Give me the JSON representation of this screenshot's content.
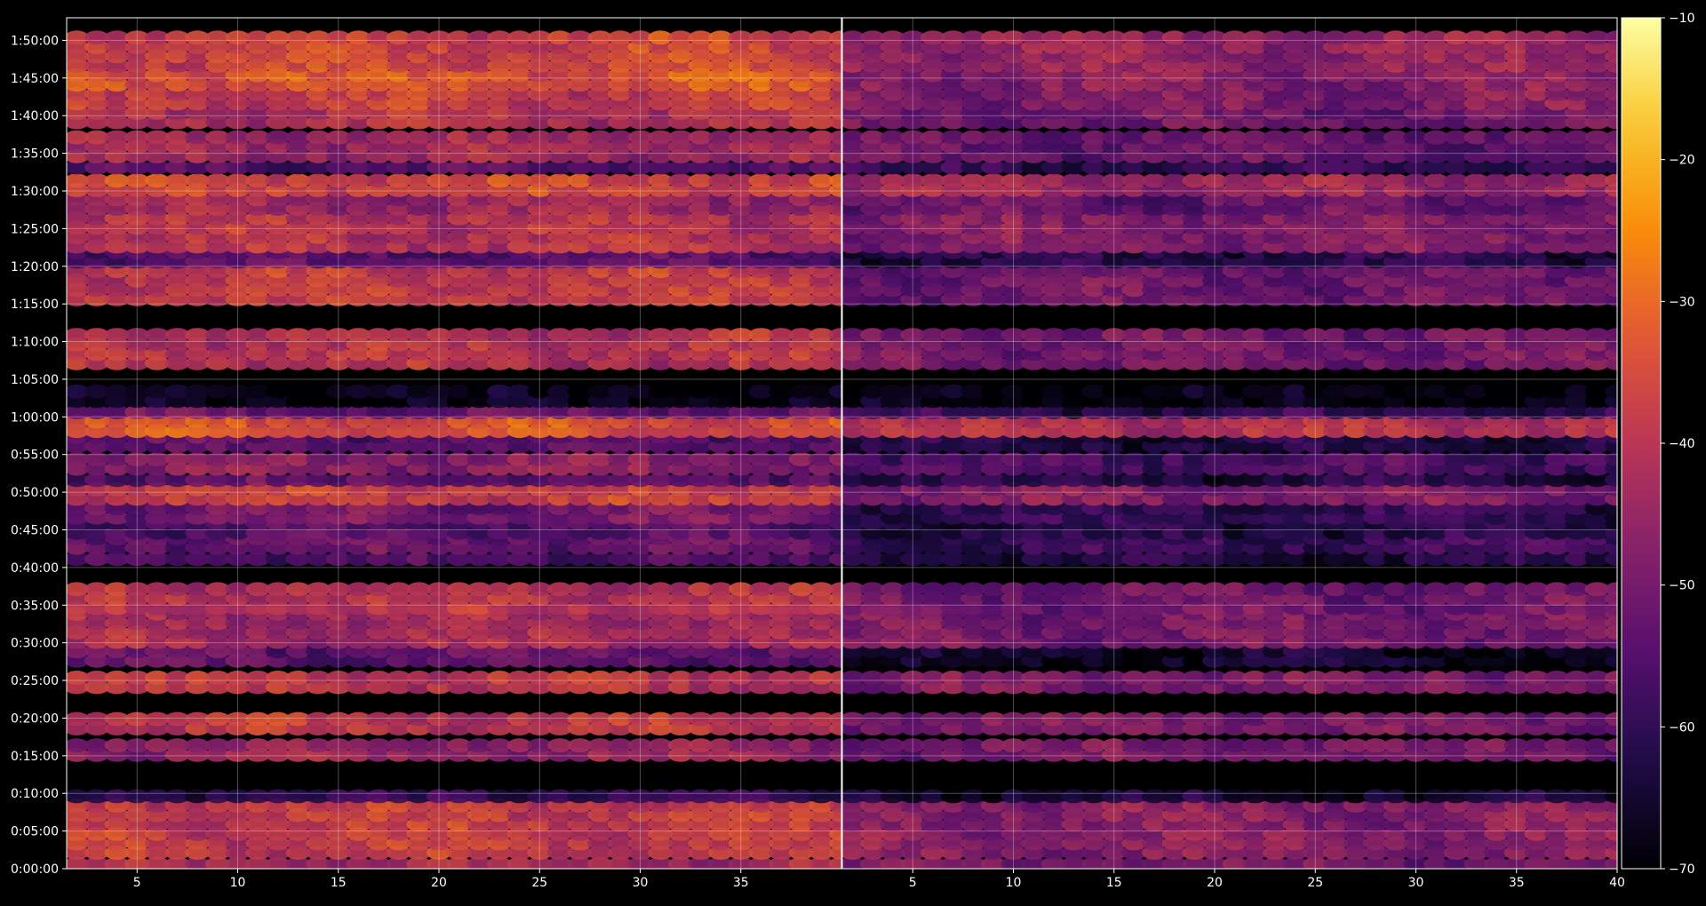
{
  "chart_data": {
    "type": "heatmap",
    "title": "",
    "xlabel": "",
    "ylabel": "",
    "grid": true,
    "panels": [
      {
        "name": "",
        "xlim": [
          1.5,
          40
        ],
        "x_ticks": [
          5,
          10,
          15,
          20,
          25,
          30,
          35
        ],
        "x_tick_labels": [
          "5",
          "10",
          "15",
          "20",
          "25",
          "30",
          "35"
        ],
        "channels": [
          2,
          40
        ],
        "level_profile": [
          [
            0,
            1.5,
            -43
          ],
          [
            1.5,
            9,
            -38
          ],
          [
            9,
            10.5,
            -60
          ],
          [
            14.5,
            16.5,
            -45
          ],
          [
            18,
            21,
            -39
          ],
          [
            23.5,
            25.5,
            -39
          ],
          [
            27,
            29.5,
            -53
          ],
          [
            29.5,
            34,
            -43
          ],
          [
            34,
            37.5,
            -40
          ],
          [
            40.5,
            42,
            -56
          ],
          [
            42,
            44,
            -52
          ],
          [
            44,
            46,
            -55
          ],
          [
            46,
            48.5,
            -50
          ],
          [
            48.5,
            51,
            -37
          ],
          [
            51,
            52.5,
            -53
          ],
          [
            52.5,
            55.5,
            -47
          ],
          [
            55.5,
            57.5,
            -54
          ],
          [
            57.5,
            60,
            -34
          ],
          [
            60,
            61.5,
            -52
          ],
          [
            61.5,
            63.5,
            -68
          ],
          [
            66.5,
            72,
            -40
          ],
          [
            75,
            80,
            -38
          ],
          [
            80,
            82,
            -54
          ],
          [
            82,
            86.5,
            -40
          ],
          [
            87,
            89.5,
            -44
          ],
          [
            89.5,
            91.5,
            -36
          ],
          [
            92.5,
            94,
            -55
          ],
          [
            94,
            98,
            -44
          ],
          [
            98.5,
            101,
            -41
          ],
          [
            101,
            103.5,
            -38
          ],
          [
            103.5,
            106,
            -33
          ],
          [
            106,
            111,
            -36
          ]
        ]
      },
      {
        "name": "",
        "xlim": [
          1.5,
          40
        ],
        "x_ticks": [
          5,
          10,
          15,
          20,
          25,
          30,
          35,
          40
        ],
        "x_tick_labels": [
          "5",
          "10",
          "15",
          "20",
          "25",
          "30",
          "35",
          "40"
        ],
        "channels": [
          2,
          40
        ],
        "level_profile": [
          [
            0,
            1.5,
            -50
          ],
          [
            1.5,
            9,
            -47
          ],
          [
            9,
            10.5,
            -64
          ],
          [
            14.5,
            16.5,
            -50
          ],
          [
            18,
            21,
            -49
          ],
          [
            23.5,
            25.5,
            -49
          ],
          [
            27,
            29.5,
            -66
          ],
          [
            29.5,
            34,
            -50
          ],
          [
            34,
            37.5,
            -51
          ],
          [
            40.5,
            42,
            -62
          ],
          [
            42,
            44,
            -58
          ],
          [
            44,
            46,
            -62
          ],
          [
            46,
            48.5,
            -60
          ],
          [
            48.5,
            51,
            -48
          ],
          [
            51,
            52.5,
            -62
          ],
          [
            52.5,
            55.5,
            -56
          ],
          [
            55.5,
            57.5,
            -62
          ],
          [
            57.5,
            60,
            -40
          ],
          [
            60,
            61.5,
            -60
          ],
          [
            61.5,
            63.5,
            -69
          ],
          [
            66.5,
            72,
            -50
          ],
          [
            75,
            80,
            -51
          ],
          [
            80,
            82,
            -62
          ],
          [
            82,
            86.5,
            -48
          ],
          [
            87,
            89.5,
            -52
          ],
          [
            89.5,
            91.5,
            -44
          ],
          [
            92.5,
            94,
            -60
          ],
          [
            94,
            98,
            -52
          ],
          [
            98.5,
            101,
            -51
          ],
          [
            101,
            103.5,
            -48
          ],
          [
            103.5,
            106,
            -47
          ],
          [
            106,
            111,
            -45
          ]
        ]
      }
    ],
    "y_unit": "minutes",
    "ylim": [
      0,
      113
    ],
    "y_ticks": [
      0,
      5,
      10,
      15,
      20,
      25,
      30,
      35,
      40,
      45,
      50,
      55,
      60,
      65,
      70,
      75,
      80,
      85,
      90,
      95,
      100,
      105,
      110
    ],
    "y_tick_labels": [
      "0:00:00",
      "0:05:00",
      "0:10:00",
      "0:15:00",
      "0:20:00",
      "0:25:00",
      "0:30:00",
      "0:35:00",
      "0:40:00",
      "0:45:00",
      "0:50:00",
      "0:55:00",
      "1:00:00",
      "1:05:00",
      "1:10:00",
      "1:15:00",
      "1:20:00",
      "1:25:00",
      "1:30:00",
      "1:35:00",
      "1:40:00",
      "1:45:00",
      "1:50:00"
    ],
    "colorbar": {
      "colormap": "inferno",
      "range": [
        -70,
        -10
      ],
      "ticks": [
        -10,
        -20,
        -30,
        -40,
        -50,
        -60,
        -70
      ],
      "tick_labels": [
        "−10",
        "−20",
        "−30",
        "−40",
        "−50",
        "−60",
        "−70"
      ]
    },
    "colors": {
      "background": "#000000",
      "axis": "#ffffff",
      "grid": "#ffffff"
    }
  }
}
